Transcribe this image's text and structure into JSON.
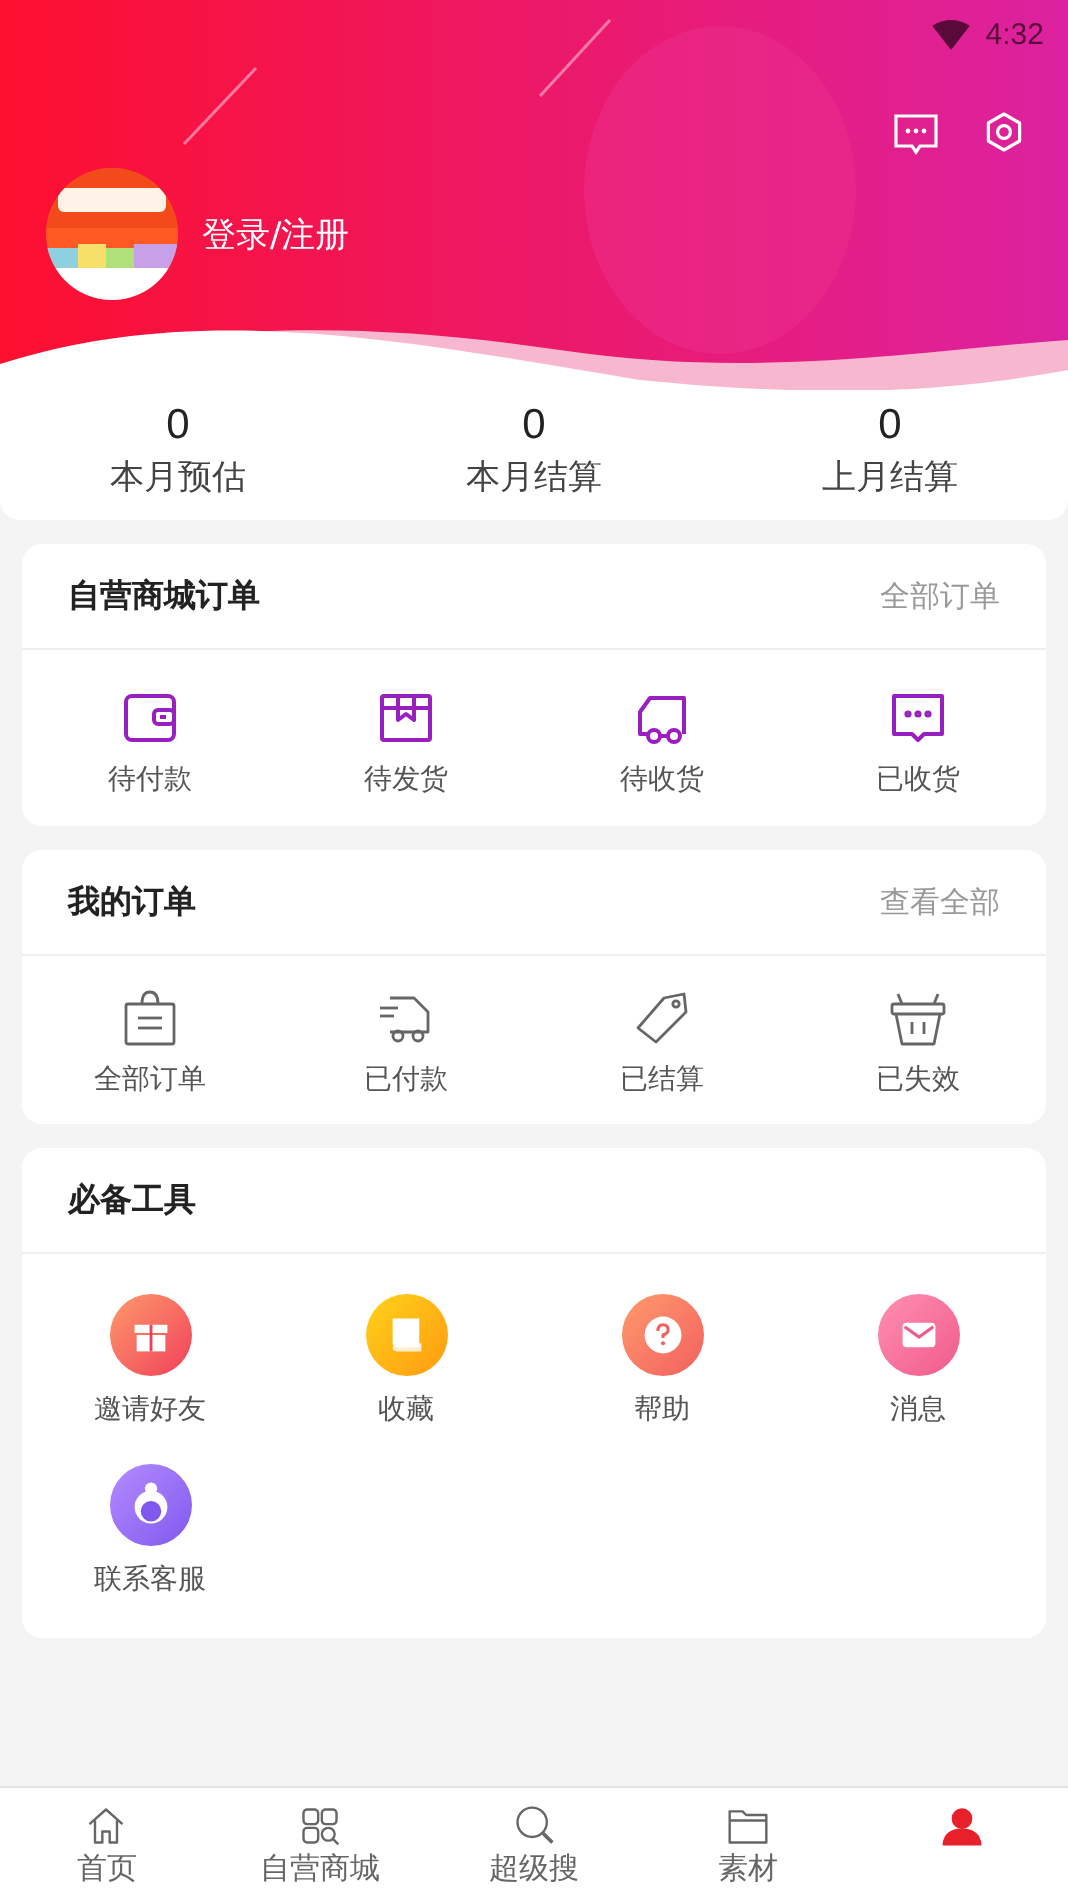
{
  "status_bar": {
    "time": "4:32"
  },
  "profile": {
    "login_label": "登录/注册"
  },
  "stats": [
    {
      "value": "0",
      "label": "本月预估"
    },
    {
      "value": "0",
      "label": "本月结算"
    },
    {
      "value": "0",
      "label": "上月结算"
    }
  ],
  "shop_orders": {
    "title": "自营商城订单",
    "link": "全部订单",
    "items": [
      {
        "kind": "wallet",
        "label": "待付款"
      },
      {
        "kind": "box",
        "label": "待发货"
      },
      {
        "kind": "truck",
        "label": "待收货"
      },
      {
        "kind": "chat",
        "label": "已收货"
      }
    ]
  },
  "my_orders": {
    "title": "我的订单",
    "link": "查看全部",
    "items": [
      {
        "kind": "bag",
        "label": "全部订单"
      },
      {
        "kind": "van",
        "label": "已付款"
      },
      {
        "kind": "tag",
        "label": "已结算"
      },
      {
        "kind": "basket",
        "label": "已失效"
      }
    ]
  },
  "tools": {
    "title": "必备工具",
    "items": [
      {
        "kind": "gift",
        "label": "邀请好友"
      },
      {
        "kind": "book",
        "label": "收藏"
      },
      {
        "kind": "help",
        "label": "帮助"
      },
      {
        "kind": "mail",
        "label": "消息"
      },
      {
        "kind": "service",
        "label": "联系客服"
      }
    ]
  },
  "tab_bar": [
    {
      "kind": "home",
      "label": "首页",
      "selected": false
    },
    {
      "kind": "grid",
      "label": "自营商城",
      "selected": false
    },
    {
      "kind": "search",
      "label": "超级搜",
      "selected": false
    },
    {
      "kind": "folder",
      "label": "素材",
      "selected": false
    },
    {
      "kind": "person",
      "selected": true
    }
  ]
}
